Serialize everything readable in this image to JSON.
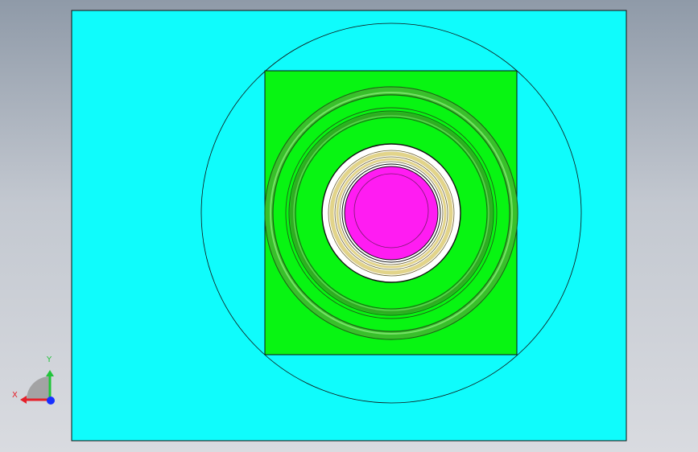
{
  "viewport": {
    "colors": {
      "base_plate": "#0ffcfc",
      "cavity_block": "#08f512",
      "ring": "#2bbf1e",
      "ring_dark": "#1f5f16",
      "bearing_face": "#ffffff",
      "bearing_gold": "#e2d48a",
      "bearing_dark": "#6b5f2a",
      "core": "#ff1cf2",
      "outline": "#111111"
    }
  },
  "triad": {
    "x_label": "X",
    "y_label": "Y",
    "colors": {
      "x": "#e5202a",
      "y": "#21c43a",
      "z": "#1730ff",
      "plane": "#9a9a9a"
    }
  }
}
